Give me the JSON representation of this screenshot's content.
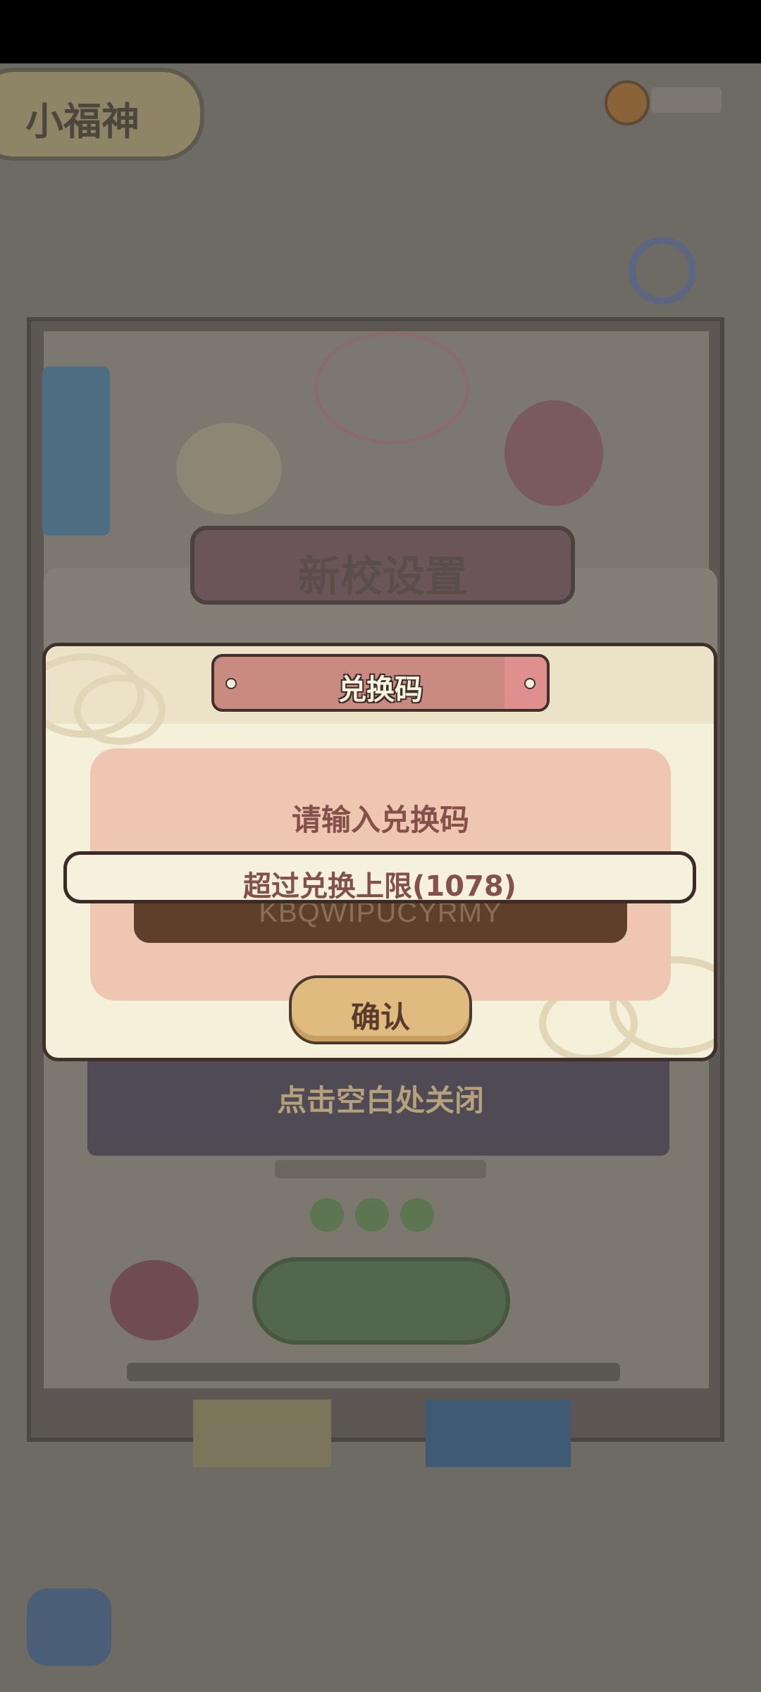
{
  "background": {
    "top_left_title": "小福神",
    "panel_title": "新校设置"
  },
  "dialog": {
    "title": "兑换码",
    "prompt": "请输入兑换码",
    "code_value": "KBQWIPUCYRMY",
    "confirm_label": "确认",
    "toast": "超过兑换上限(1078)",
    "close_hint": "点击空白处关闭"
  },
  "colors": {
    "modal_bg": "#f5f0d9",
    "title_plaque": "#c98a82",
    "inner_panel": "#eec6b2",
    "code_field": "#5e3f2b",
    "confirm_button": "#dfbb80",
    "text_brown": "#83504a"
  }
}
